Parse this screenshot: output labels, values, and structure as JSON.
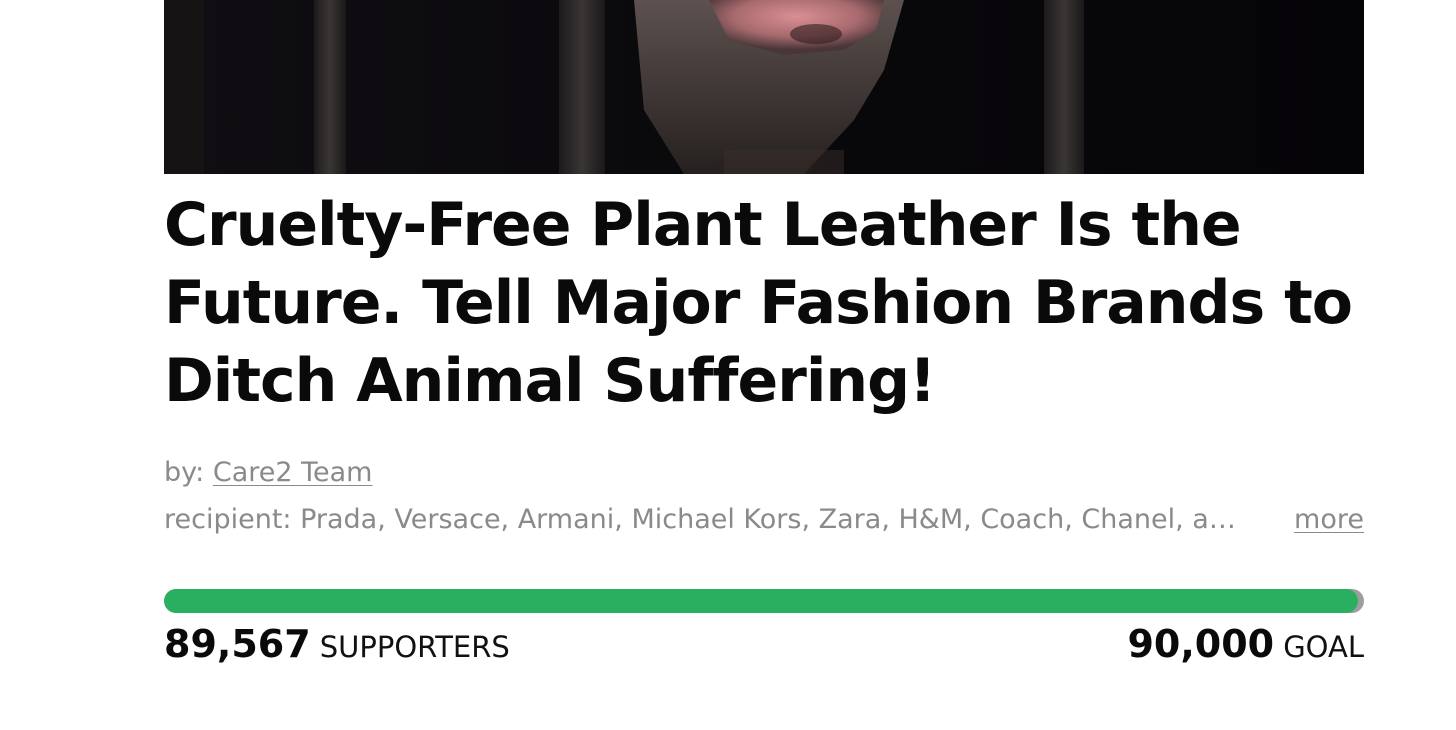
{
  "petition": {
    "title": "Cruelty-Free Plant Leather Is the Future. Tell Major Fashion Brands to Ditch Animal Suffering!",
    "by_prefix": "by: ",
    "author": "Care2 Team",
    "recipient_text": "recipient: Prada, Versace, Armani, Michael Kors, Zara, H&M, Coach, Chanel, and others",
    "more_label": "more"
  },
  "progress": {
    "supporters_count": "89,567",
    "supporters_label": "SUPPORTERS",
    "goal_count": "90,000",
    "goal_label": "GOAL",
    "fraction": 0.995
  },
  "colors": {
    "progress_fill": "#2aaf61",
    "progress_track": "#9e9e9e",
    "muted_text": "#8a8a8a"
  }
}
